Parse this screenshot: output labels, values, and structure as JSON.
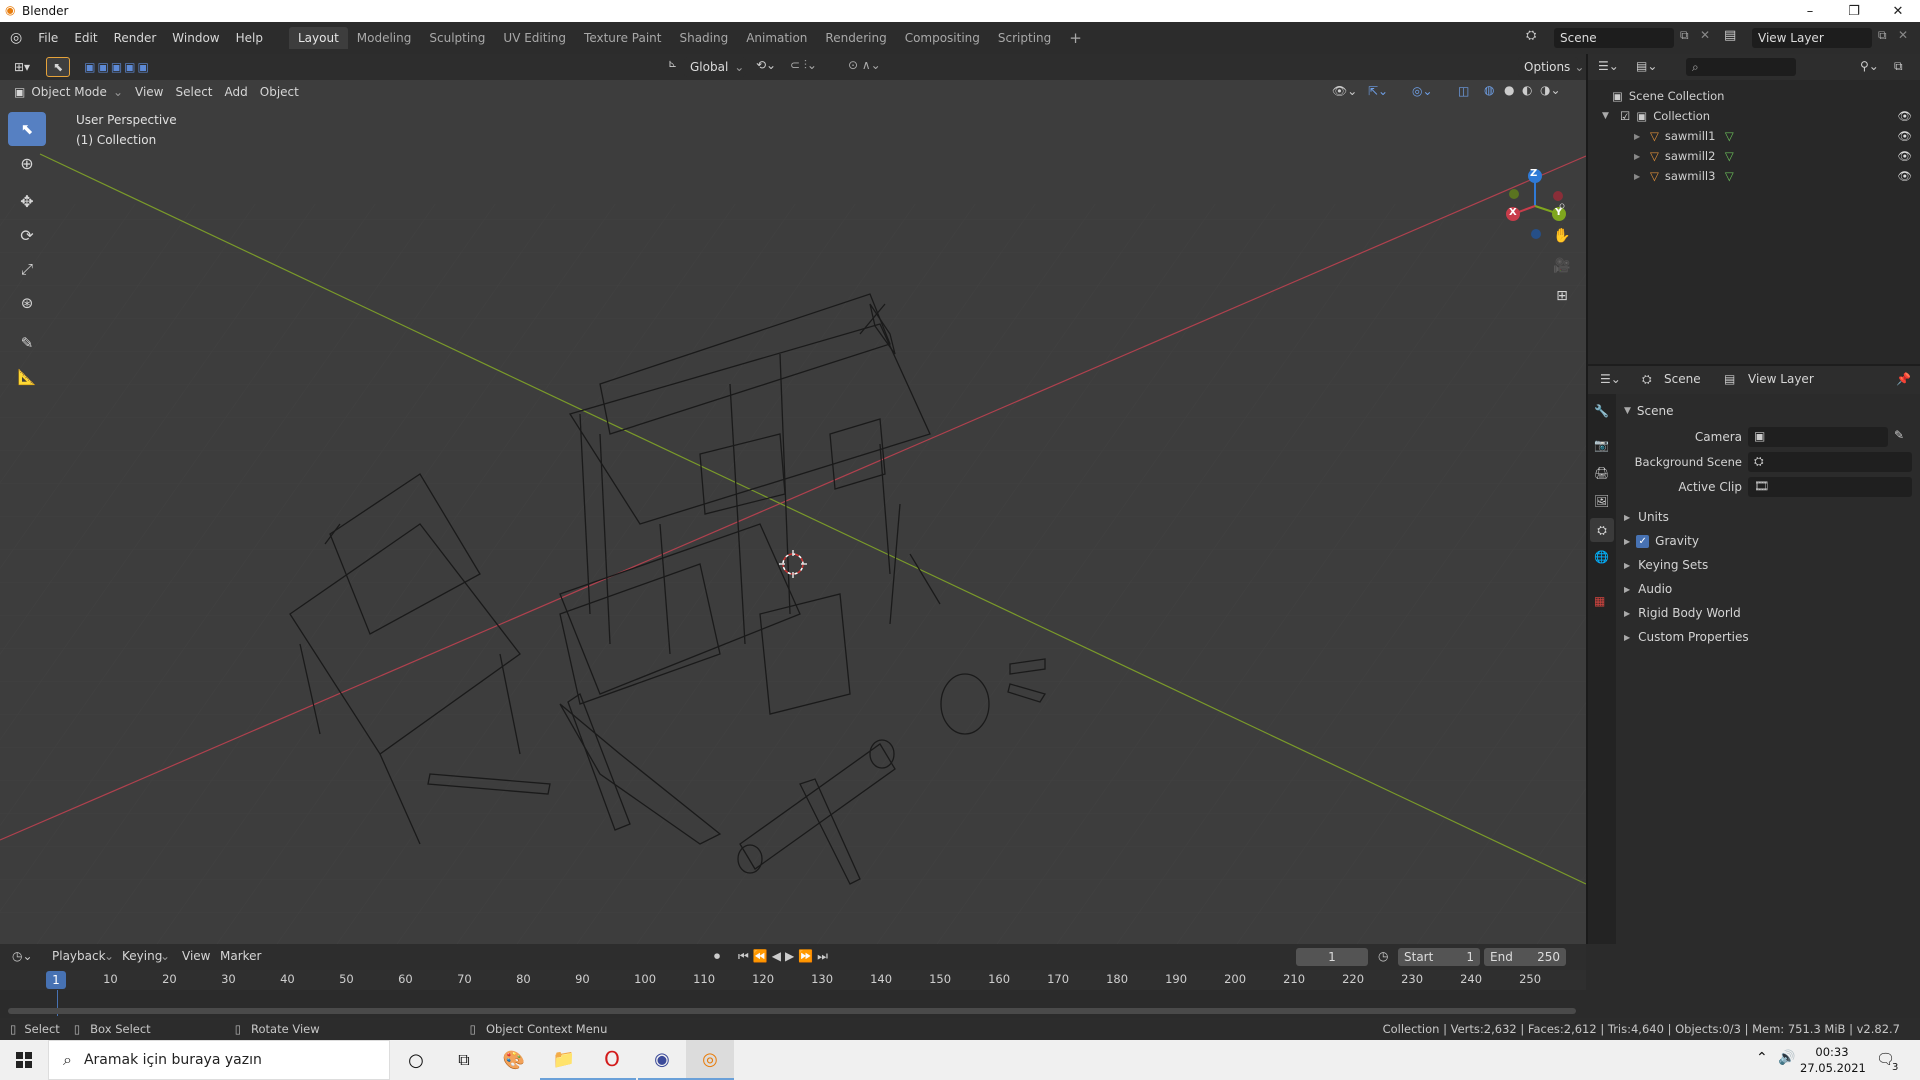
{
  "window": {
    "title": "Blender",
    "controls": [
      "–",
      "❐",
      "✕"
    ]
  },
  "menus": [
    "File",
    "Edit",
    "Render",
    "Window",
    "Help"
  ],
  "workspaces": [
    "Layout",
    "Modeling",
    "Sculpting",
    "UV Editing",
    "Texture Paint",
    "Shading",
    "Animation",
    "Rendering",
    "Compositing",
    "Scripting"
  ],
  "active_workspace": "Layout",
  "scene_selector": "Scene",
  "view_layer_selector": "View Layer",
  "viewport": {
    "mode": "Object Mode",
    "menu": [
      "View",
      "Select",
      "Add",
      "Object"
    ],
    "orientation": "Global",
    "options_label": "Options",
    "overlay_line1": "User Perspective",
    "overlay_line2": "(1) Collection",
    "gizmo_labels": {
      "x": "X",
      "y": "Y",
      "z": "Z"
    },
    "axis_colors": {
      "x": "#c83c4a",
      "y": "#7fa61e",
      "z": "#2f7ad6"
    }
  },
  "outliner": {
    "root": "Scene Collection",
    "collection": "Collection",
    "objects": [
      "sawmill1",
      "sawmill2",
      "sawmill3"
    ]
  },
  "properties": {
    "tab_scene": "Scene",
    "tab_view_layer": "View Layer",
    "panel_title": "Scene",
    "fields": {
      "camera": "Camera",
      "background_scene": "Background Scene",
      "active_clip": "Active Clip"
    },
    "sections": [
      "Units",
      "Gravity",
      "Keying Sets",
      "Audio",
      "Rigid Body World",
      "Custom Properties"
    ],
    "gravity_checked": true
  },
  "timeline": {
    "menu": [
      "Playback",
      "Keying",
      "View",
      "Marker"
    ],
    "current_frame": "1",
    "start_label": "Start",
    "start": "1",
    "end_label": "End",
    "end": "250",
    "ruler": [
      "10",
      "20",
      "30",
      "40",
      "50",
      "60",
      "70",
      "80",
      "90",
      "100",
      "110",
      "120",
      "130",
      "140",
      "150",
      "160",
      "170",
      "180",
      "190",
      "200",
      "210",
      "220",
      "230",
      "240",
      "250"
    ],
    "playhead": "1"
  },
  "status": {
    "select": "Select",
    "box_select": "Box Select",
    "rotate_view": "Rotate View",
    "context_menu": "Object Context Menu",
    "stats": "Collection | Verts:2,632 | Faces:2,612 | Tris:4,640 | Objects:0/3 | Mem: 751.3 MiB | v2.82.7"
  },
  "taskbar": {
    "search_placeholder": "Aramak için buraya yazın",
    "time": "00:33",
    "date": "27.05.2021",
    "notification_count": "3"
  }
}
